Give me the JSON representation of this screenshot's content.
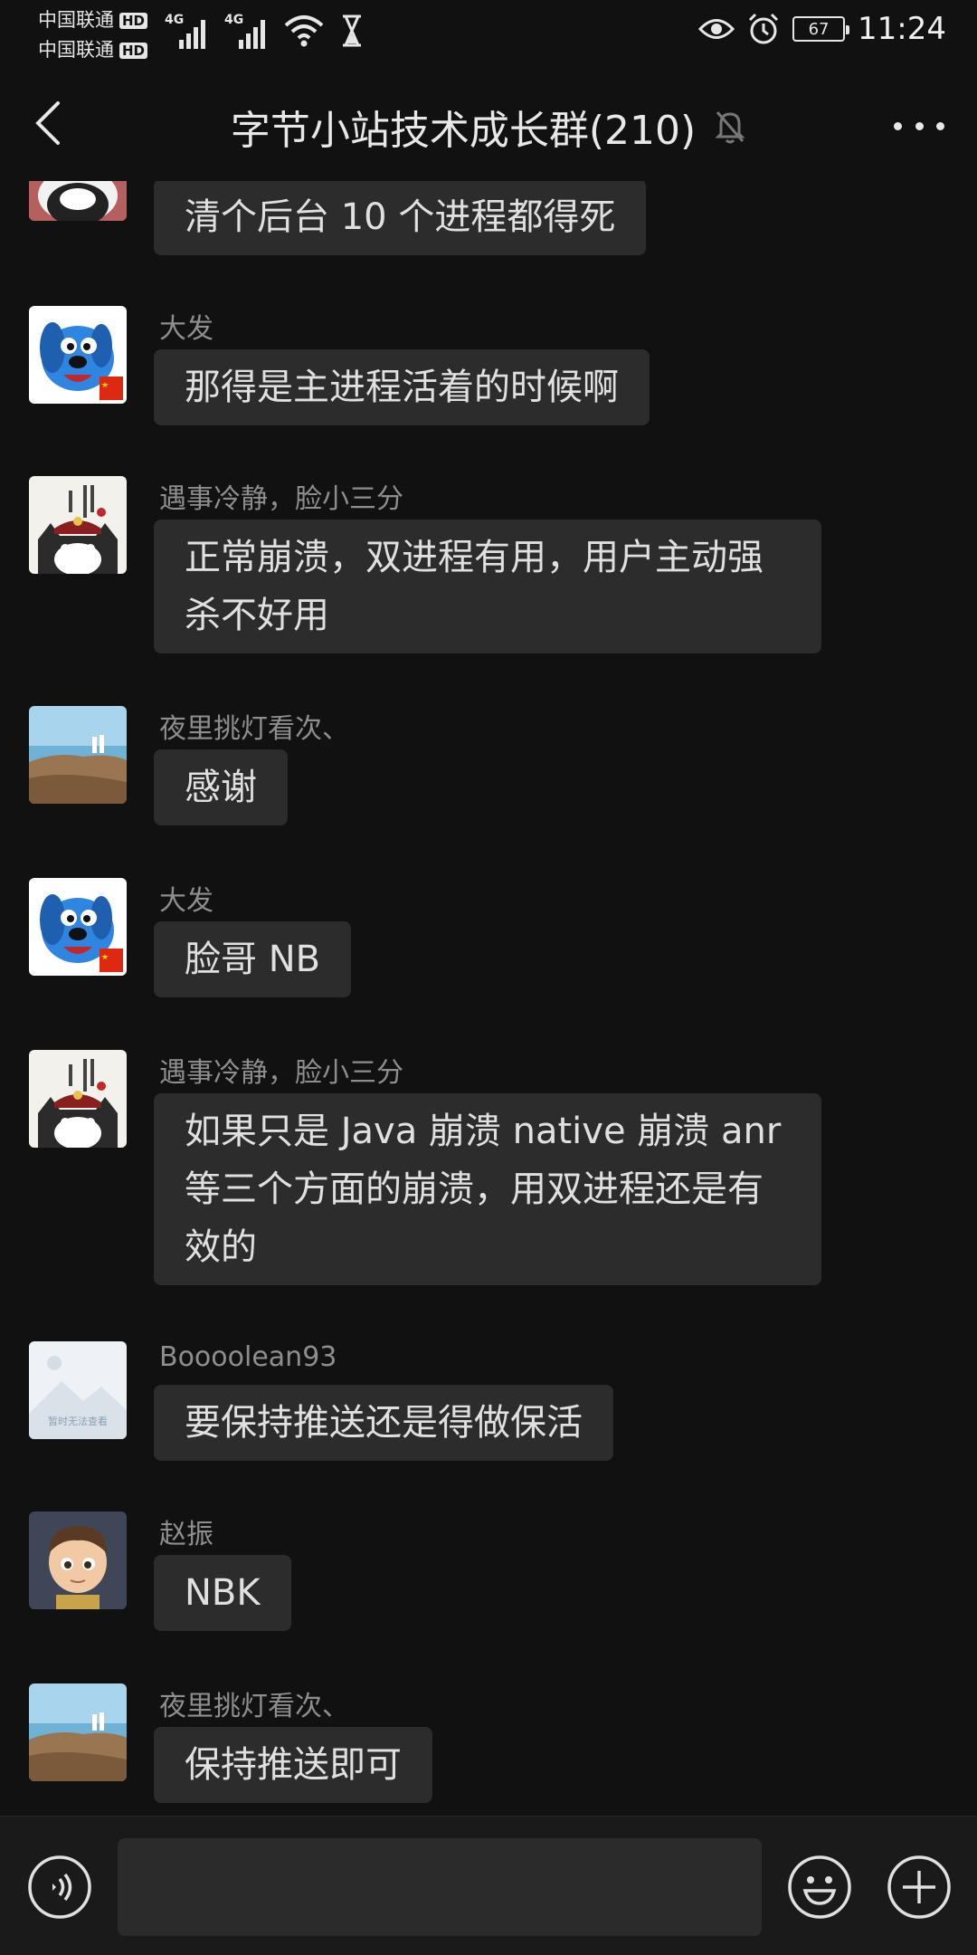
{
  "statusbar": {
    "carrier1": "中国联通",
    "carrier2": "中国联通",
    "hd": "HD",
    "net1": "4G",
    "net2": "4G",
    "battery": "67",
    "time": "11:24"
  },
  "header": {
    "title": "字节小站技术成长群(210)"
  },
  "messages": [
    {
      "sender": "",
      "text": "清个后台 10 个进程都得死",
      "avatar": "panda-avatar"
    },
    {
      "sender": "大发",
      "text": "那得是主进程活着的时候啊",
      "avatar": "blue-dog-avatar"
    },
    {
      "sender": "遇事冷静，脸小三分",
      "text": "正常崩溃，双进程有用，用户主动强杀不好用",
      "avatar": "cat-avatar"
    },
    {
      "sender": "夜里挑灯看次、",
      "text": "感谢",
      "avatar": "beach-avatar"
    },
    {
      "sender": "大发",
      "text": "脸哥 NB",
      "avatar": "blue-dog-avatar"
    },
    {
      "sender": "遇事冷静，脸小三分",
      "text": "如果只是 Java 崩溃 native 崩溃 anr 等三个方面的崩溃，用双进程还是有效的",
      "avatar": "cat-avatar"
    },
    {
      "sender": "Boooolean93",
      "text": "要保持推送还是得做保活",
      "avatar": "placeholder-image-avatar"
    },
    {
      "sender": "赵振",
      "text": "NBK",
      "avatar": "boy-avatar"
    },
    {
      "sender": "夜里挑灯看次、",
      "text": "保持推送即可",
      "avatar": "beach-avatar"
    }
  ],
  "placeholder_avatar_text": "暂时无法查看",
  "icons": {
    "back": "back-arrow-icon",
    "mute": "bell-off-icon",
    "more": "more-dots-icon",
    "voice": "voice-icon",
    "emoji": "emoji-icon",
    "plus": "plus-icon"
  }
}
